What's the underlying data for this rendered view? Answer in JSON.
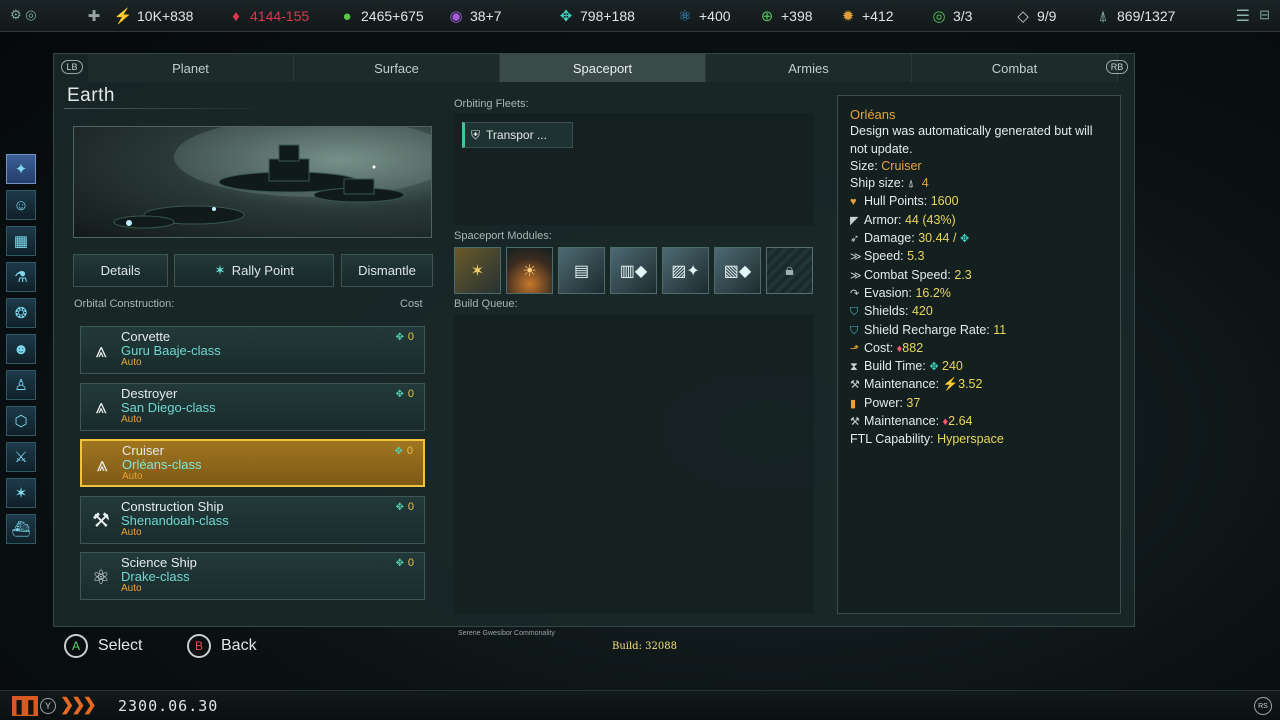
{
  "resources": [
    {
      "icon": "energy-icon",
      "glyph": "⚡",
      "color": "#e6c43a",
      "value": "10K+838",
      "value_color": "#dfe5e5"
    },
    {
      "icon": "minerals-icon",
      "glyph": "♦",
      "color": "#e0354f",
      "value": "4144-155",
      "value_color": "#e0354f"
    },
    {
      "icon": "food-icon",
      "glyph": "●",
      "color": "#55c845",
      "value": "2465+675",
      "value_color": "#dfe5e5"
    },
    {
      "icon": "influence-icon",
      "glyph": "◉",
      "color": "#a65bd8",
      "value": "38+7",
      "value_color": "#dfe5e5"
    },
    {
      "icon": "unity-icon",
      "glyph": "✥",
      "color": "#43d1c0",
      "value": "798+188",
      "value_color": "#dfe5e5"
    },
    {
      "icon": "physics-research-icon",
      "glyph": "⚛",
      "color": "#3aa6e0",
      "value": "+400",
      "value_color": "#dfe5e5"
    },
    {
      "icon": "society-research-icon",
      "glyph": "⊕",
      "color": "#4fc85a",
      "value": "+398",
      "value_color": "#dfe5e5"
    },
    {
      "icon": "engineering-research-icon",
      "glyph": "✹",
      "color": "#e0a13a",
      "value": "+412",
      "value_color": "#dfe5e5"
    },
    {
      "icon": "edicts-icon",
      "glyph": "◎",
      "color": "#4fc85a",
      "value": "3/3",
      "value_color": "#dfe5e5"
    },
    {
      "icon": "planets-icon",
      "glyph": "◇",
      "color": "#c9d0d0",
      "value": "9/9",
      "value_color": "#dfe5e5"
    },
    {
      "icon": "fleet-capacity-icon",
      "glyph": "⍋",
      "color": "#8fb4b0",
      "value": "869/1327",
      "value_color": "#dfe5e5"
    }
  ],
  "tabs": {
    "lb": "LB",
    "rb": "RB",
    "items": [
      "Planet",
      "Surface",
      "Spaceport",
      "Armies",
      "Combat"
    ],
    "active": "Spaceport"
  },
  "planet": {
    "name": "Earth",
    "buttons": {
      "details": "Details",
      "rally": "Rally Point",
      "dismantle": "Dismantle"
    }
  },
  "labels": {
    "orbital_construction": "Orbital Construction:",
    "cost": "Cost",
    "orbiting_fleets": "Orbiting Fleets:",
    "spaceport_modules": "Spaceport Modules:",
    "build_queue": "Build Queue:"
  },
  "fleets": [
    {
      "name": "Transpor ..."
    }
  ],
  "construction": [
    {
      "type": "Corvette",
      "design": "Guru Baaje-class",
      "mode": "Auto",
      "cost": "0",
      "icon": "rank-icon",
      "selected": false
    },
    {
      "type": "Destroyer",
      "design": "San Diego-class",
      "mode": "Auto",
      "cost": "0",
      "icon": "rank-icon",
      "selected": false
    },
    {
      "type": "Cruiser",
      "design": "Orléans-class",
      "mode": "Auto",
      "cost": "0",
      "icon": "rank-icon",
      "selected": true
    },
    {
      "type": "Construction Ship",
      "design": "Shenandoah-class",
      "mode": "Auto",
      "cost": "0",
      "icon": "tools-icon",
      "selected": false
    },
    {
      "type": "Science Ship",
      "design": "Drake-class",
      "mode": "Auto",
      "cost": "0",
      "icon": "atom-icon",
      "selected": false
    }
  ],
  "details": {
    "name": "Orléans",
    "desc": "Design was automatically generated but will not update.",
    "size_label": "Size:",
    "size": "Cruiser",
    "ship_size_label": "Ship size:",
    "ship_size": "4",
    "hull_label": "Hull Points:",
    "hull": "1600",
    "armor_label": "Armor:",
    "armor": "44 (43%)",
    "damage_label": "Damage:",
    "damage": "30.44 /",
    "speed_label": "Speed:",
    "speed": "5.3",
    "combat_speed_label": "Combat Speed:",
    "combat_speed": "2.3",
    "evasion_label": "Evasion:",
    "evasion": "16.2%",
    "shields_label": "Shields:",
    "shields": "420",
    "recharge_label": "Shield Recharge Rate:",
    "recharge": "11",
    "cost_label": "Cost:",
    "cost": "882",
    "build_time_label": "Build Time:",
    "build_time": "240",
    "maintenance_label": "Maintenance:",
    "maintenance_energy": "3.52",
    "power_label": "Power:",
    "power": "37",
    "maintenance2_label": "Maintenance:",
    "maintenance_minerals": "2.64",
    "ftl_label": "FTL Capability:",
    "ftl": "Hyperspace"
  },
  "controls": {
    "a": "A",
    "select": "Select",
    "b": "B",
    "back": "Back"
  },
  "status_text": "Serene Gwesibor Commonality",
  "build_text": "Build: 32088",
  "date": "2300.06.30",
  "bottom": {
    "y": "Y",
    "rs": "RS"
  }
}
